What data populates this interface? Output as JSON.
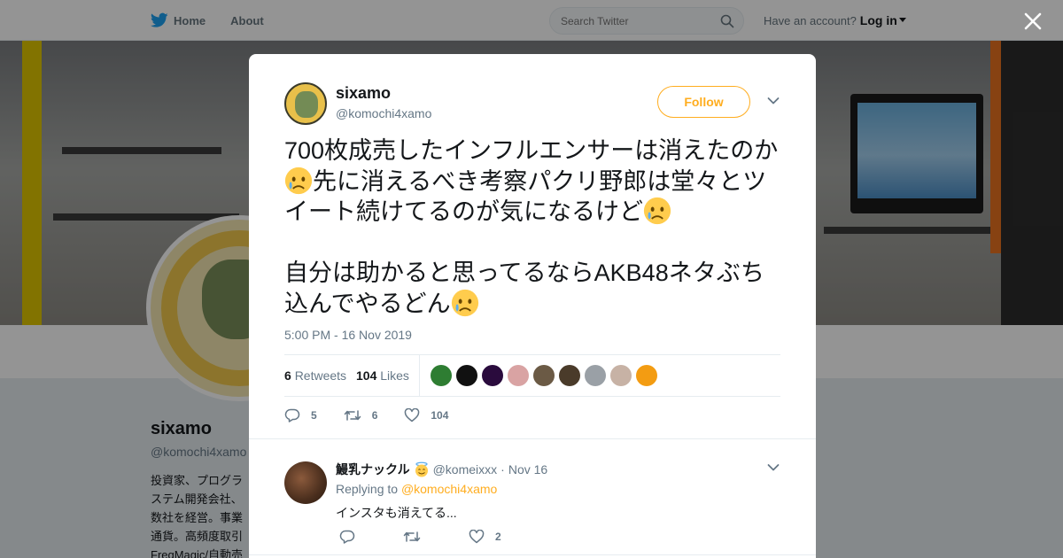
{
  "nav": {
    "home_label": "Home",
    "about_label": "About",
    "search_placeholder": "Search Twitter",
    "account_prompt": "Have an account?",
    "login_label": "Log in",
    "brand_color": "#1da1f2"
  },
  "profile": {
    "name": "sixamo",
    "handle": "@komochi4xamo",
    "bio_lines": [
      "投資家、プログラ",
      "ステム開発会社、",
      "数社を経営。事業",
      "通貨。高頻度取引",
      "FreqMagic/自動売"
    ]
  },
  "tweet": {
    "name": "sixamo",
    "handle": "@komochi4xamo",
    "follow_label": "Follow",
    "text_part1": "700枚成売したインフルエンサーは消えたのか",
    "text_part2": "先に消えるべき考察パクリ野郎は堂々とツイート続けてるのが気になるけど",
    "text_part3": "自分は助かると思ってるならAKB48ネタぶち込んでやるどん",
    "emoji": "crying-face",
    "timestamp": "5:00 PM - 16 Nov 2019",
    "retweets_count": "6",
    "retweets_label": "Retweets",
    "likes_count": "104",
    "likes_label": "Likes",
    "liker_colors": [
      "#2e7d32",
      "#111111",
      "#2a0b3d",
      "#d9a3a3",
      "#6b5a45",
      "#4a3b2a",
      "#9aa0a6",
      "#c7b2a5",
      "#f39c12"
    ],
    "actions": {
      "replies": "5",
      "retweets": "6",
      "likes": "104"
    },
    "accent": "#ffad1f"
  },
  "reply": {
    "name": "鰻乳ナックル",
    "handle": "@komeixxx",
    "separator": "·",
    "date": "Nov 16",
    "replying_to_label": "Replying to",
    "replying_to_handle": "@komochi4xamo",
    "text": "インスタも消えてる...",
    "actions": {
      "replies": "",
      "retweets": "",
      "likes": "2"
    }
  }
}
